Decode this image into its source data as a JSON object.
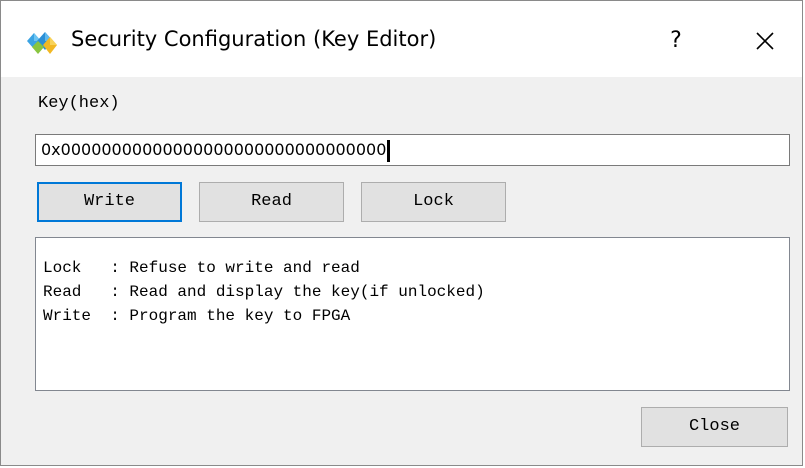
{
  "window": {
    "title": "Security Configuration (Key Editor)",
    "help_label": "?",
    "close_icon": "close-icon",
    "app_icon": "diamond-logo-icon"
  },
  "key": {
    "label": "Key(hex)",
    "value": "0x00000000000000000000000000000000"
  },
  "buttons": {
    "write": "Write",
    "read": "Read",
    "lock": "Lock",
    "close": "Close"
  },
  "info": {
    "lines": [
      "Lock   : Refuse to write and read",
      "Read   : Read and display the key(if unlocked)",
      "Write  : Program the key to FPGA"
    ]
  },
  "colors": {
    "accent": "#0078d7",
    "window_bg": "#f0f0f0",
    "button_bg": "#e1e1e1"
  }
}
